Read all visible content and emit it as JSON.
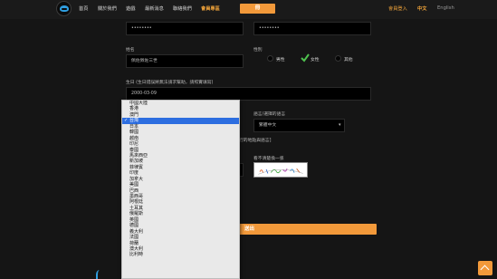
{
  "nav": {
    "items": [
      "首頁",
      "關於我們",
      "遊戲",
      "最新消息",
      "聯絡我們",
      "會員專區"
    ],
    "register_label": "冊",
    "login_label": "會員登入",
    "lang_zh": "中文",
    "lang_en": "English"
  },
  "form": {
    "password_value": "••••••••",
    "confirm_password_value": "••••••••",
    "name_label": "姓名",
    "name_value": "佩佐佩佐三世",
    "gender_label": "性別",
    "gender_options": [
      "男性",
      "女性",
      "其他"
    ],
    "gender_selected": "女性",
    "birthday_label": "生日 (生日錯誤將無法請求幫助，請照實填寫)",
    "birthday_value": "2000-03-09",
    "language_label": "語言/選擇的語言",
    "language_value": "繁體中文",
    "region_hint": "行的地點與語言]",
    "captcha_label": "看不清楚換一張",
    "submit_label": "送出"
  },
  "dropdown": {
    "options": [
      "中國大陸",
      "香港",
      "澳門",
      "台灣",
      "日本",
      "韓國",
      "越南",
      "印尼",
      "泰國",
      "馬來西亞",
      "新加坡",
      "菲律賓",
      "印度",
      "加拿大",
      "美國",
      "巴西",
      "墨西哥",
      "阿根廷",
      "土耳其",
      "俄羅斯",
      "英國",
      "德國",
      "義大利",
      "法國",
      "荷蘭",
      "澳大利",
      "比利時"
    ],
    "selected": "台灣"
  },
  "colors": {
    "accent": "#f2993a",
    "selected_item": "#2d6ee0",
    "background": "#151515"
  }
}
